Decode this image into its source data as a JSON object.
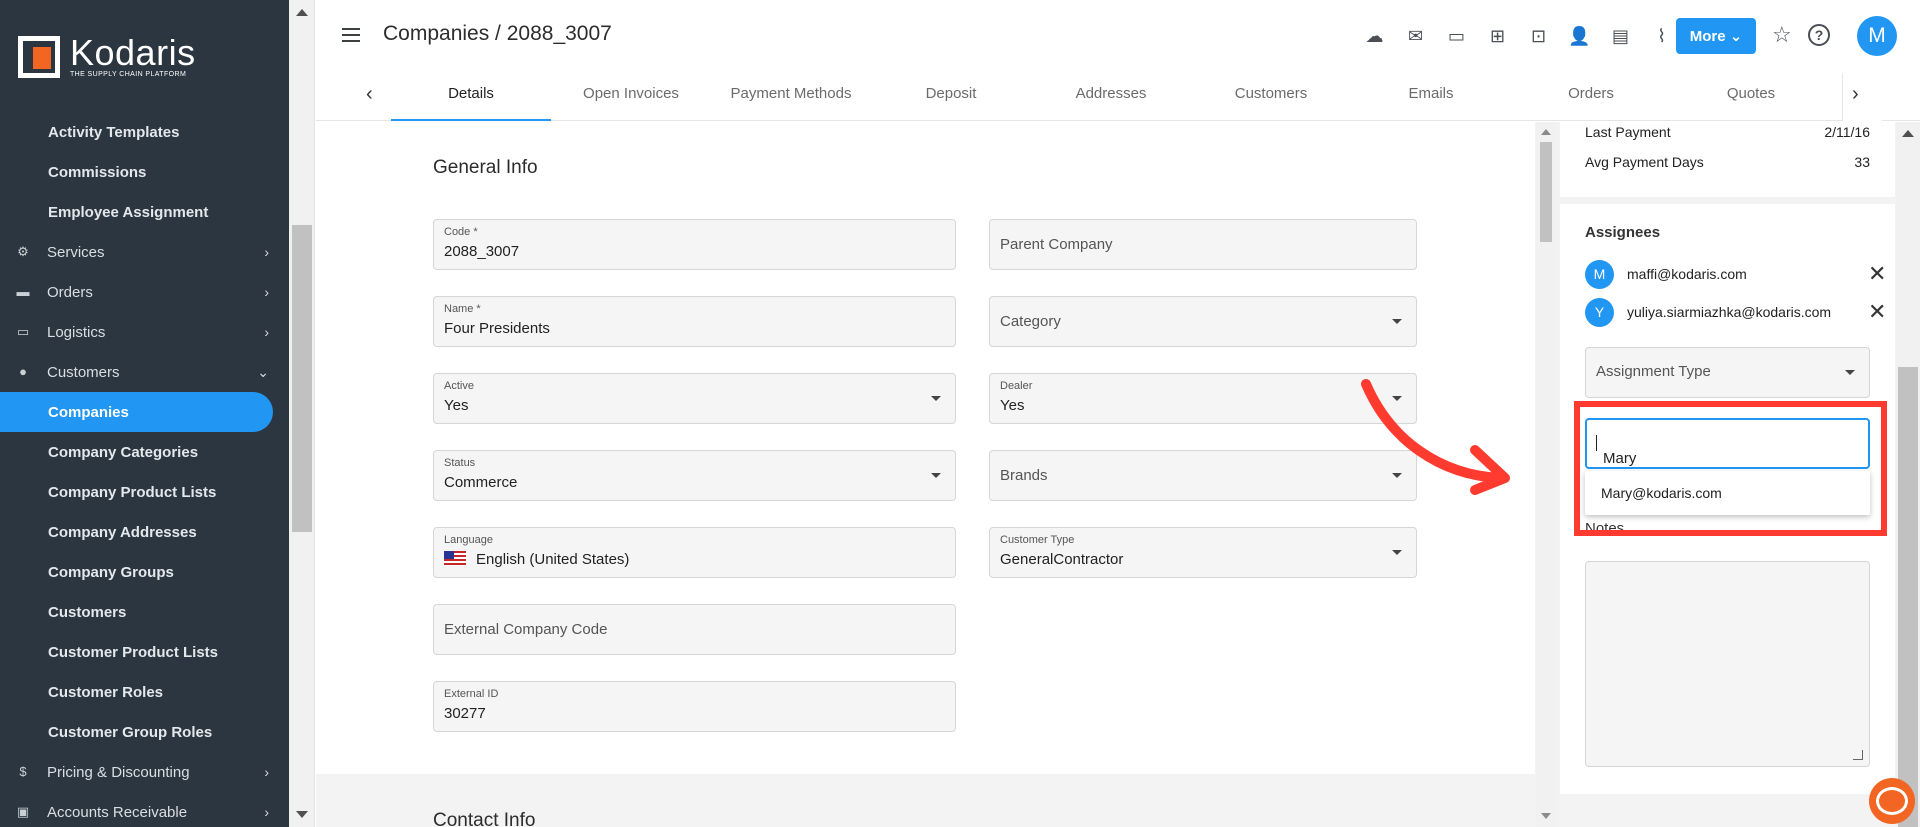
{
  "brand": {
    "name": "Kodaris",
    "tagline": "THE SUPPLY CHAIN PLATFORM",
    "accent": "#f26522",
    "primary": "#2196f3"
  },
  "sidebar": {
    "items": [
      {
        "label": "Activity Templates",
        "type": "sub"
      },
      {
        "label": "Commissions",
        "type": "sub"
      },
      {
        "label": "Employee Assignment",
        "type": "sub"
      },
      {
        "label": "Services",
        "type": "top",
        "icon": "services-icon"
      },
      {
        "label": "Orders",
        "type": "top",
        "icon": "truck-icon"
      },
      {
        "label": "Logistics",
        "type": "top",
        "icon": "logistics-icon"
      },
      {
        "label": "Customers",
        "type": "top",
        "icon": "people-icon",
        "expanded": true
      },
      {
        "label": "Companies",
        "type": "sub",
        "active": true
      },
      {
        "label": "Company Categories",
        "type": "sub"
      },
      {
        "label": "Company Product Lists",
        "type": "sub"
      },
      {
        "label": "Company Addresses",
        "type": "sub"
      },
      {
        "label": "Company Groups",
        "type": "sub"
      },
      {
        "label": "Customers",
        "type": "sub"
      },
      {
        "label": "Customer Product Lists",
        "type": "sub"
      },
      {
        "label": "Customer Roles",
        "type": "sub"
      },
      {
        "label": "Customer Group Roles",
        "type": "sub"
      },
      {
        "label": "Pricing & Discounting",
        "type": "top",
        "icon": "dollar-icon"
      },
      {
        "label": "Accounts Receivable",
        "type": "top",
        "icon": "receivable-icon"
      }
    ]
  },
  "header": {
    "title": "Companies / 2088_3007",
    "more_label": "More",
    "avatar_letter": "M",
    "icons": [
      "cloud-upload-icon",
      "mail-icon",
      "card-check-icon",
      "gift-card-icon",
      "monitor-add-icon",
      "person-add-icon",
      "file-add-icon",
      "paperclip-icon"
    ]
  },
  "tabs": [
    "Details",
    "Open Invoices",
    "Payment Methods",
    "Deposit",
    "Addresses",
    "Customers",
    "Emails",
    "Orders",
    "Quotes"
  ],
  "general_info": {
    "title": "General Info",
    "code": {
      "label": "Code *",
      "value": "2088_3007"
    },
    "parent_company": {
      "placeholder": "Parent Company"
    },
    "name": {
      "label": "Name *",
      "value": "Four Presidents"
    },
    "category": {
      "placeholder": "Category"
    },
    "active": {
      "label": "Active",
      "value": "Yes"
    },
    "dealer": {
      "label": "Dealer",
      "value": "Yes"
    },
    "status": {
      "label": "Status",
      "value": "Commerce"
    },
    "brands": {
      "placeholder": "Brands"
    },
    "language": {
      "label": "Language",
      "value": "English (United States)"
    },
    "customer_type": {
      "label": "Customer Type",
      "value": "GeneralContractor"
    },
    "external_company_code": {
      "placeholder": "External Company Code"
    },
    "external_id": {
      "label": "External ID",
      "value": "30277"
    }
  },
  "contact_info": {
    "title": "Contact Info"
  },
  "right_panel": {
    "last_payment": {
      "label": "Last Payment",
      "value": "2/11/16"
    },
    "avg_payment_days": {
      "label": "Avg Payment Days",
      "value": "33"
    },
    "assignees_title": "Assignees",
    "assignees": [
      {
        "letter": "M",
        "email": "maffi@kodaris.com"
      },
      {
        "letter": "Y",
        "email": "yuliya.siarmiazhka@kodaris.com"
      }
    ],
    "assignment_type_placeholder": "Assignment Type",
    "user_input_value": "Mary",
    "suggestion": "Mary@kodaris.com",
    "notes_label": "Notes"
  }
}
